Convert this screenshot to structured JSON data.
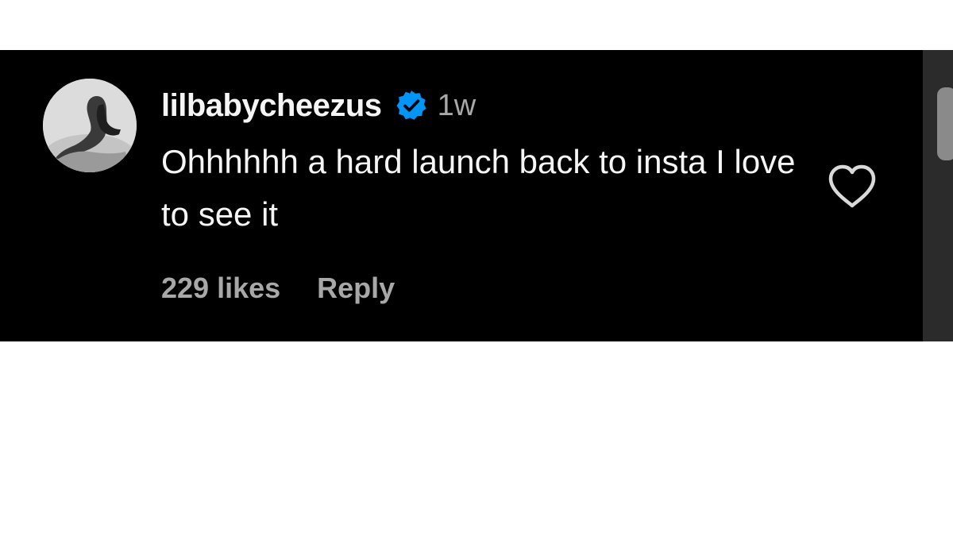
{
  "comment": {
    "username": "lilbabycheezus",
    "verified": true,
    "timestamp": "1w",
    "text": "Ohhhhhh a hard launch back to insta I love to see it",
    "likes": "229 likes",
    "reply_label": "Reply",
    "liked": false
  },
  "icons": {
    "verified": "verified-badge-icon",
    "like": "heart-outline-icon",
    "avatar": "user-avatar"
  },
  "colors": {
    "background": "#000000",
    "primary_text": "#f5f5f5",
    "secondary_text": "#a8a8a8",
    "verified_blue": "#0095f6"
  }
}
